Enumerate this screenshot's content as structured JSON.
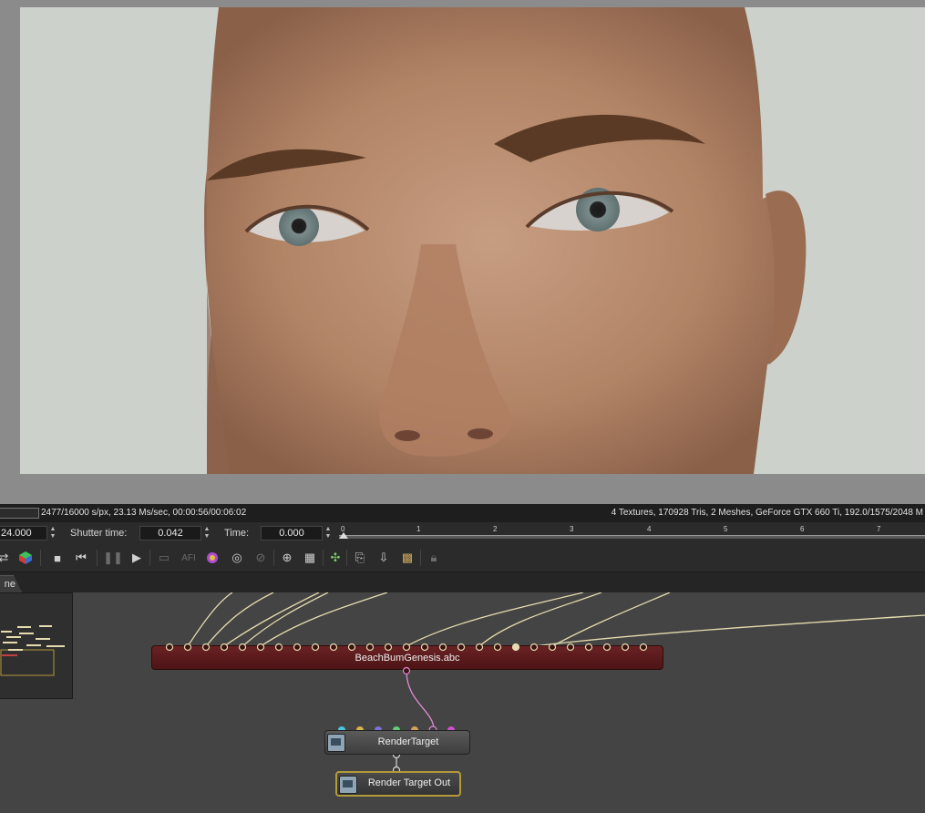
{
  "viewport": {
    "subject": "3D face render"
  },
  "status": {
    "left": "2477/16000 s/px, 23.13 Ms/sec, 00:00:56/00:06:02",
    "right": "4 Textures, 170928 Tris, 2 Meshes, GeForce GTX 660 Ti, 192.0/1575/2048 M"
  },
  "controls": {
    "fps_value": "24.000",
    "shutter_label": "Shutter time:",
    "shutter_value": "0.042",
    "time_label": "Time:",
    "time_value": "0.000",
    "timeline_ticks": [
      "0",
      "1",
      "2",
      "3",
      "4",
      "5",
      "6",
      "7"
    ]
  },
  "toolbar": {
    "icons": [
      "transform-icon",
      "color-cube-icon",
      "stop-icon",
      "rewind-icon",
      "pause-icon",
      "play-icon",
      "monitor-icon",
      "afi-icon",
      "color-wheel-icon",
      "camera-reset-icon",
      "camera-link-icon",
      "zoom-region-icon",
      "checker-icon",
      "picker-icon",
      "copy-icon",
      "export-icon",
      "grid-icon",
      "lock-icon"
    ]
  },
  "tabs": {
    "active_label": "ne"
  },
  "graph": {
    "abc_node": {
      "label": "BeachBumGenesis.abc"
    },
    "rendertarget_node": {
      "label": "RenderTarget"
    },
    "rendertarget_out_node": {
      "label": "Render Target Out"
    },
    "pin_colors": [
      "#49c6e0",
      "#d9b34a",
      "#7b72d6",
      "#5fcf78",
      "#d8a25a",
      "#d8c0a0",
      "#d04fd0"
    ],
    "wire_color": "#e6dcb0",
    "link_color": "#e389d6",
    "abc_node_color": "#5e1a1c"
  }
}
